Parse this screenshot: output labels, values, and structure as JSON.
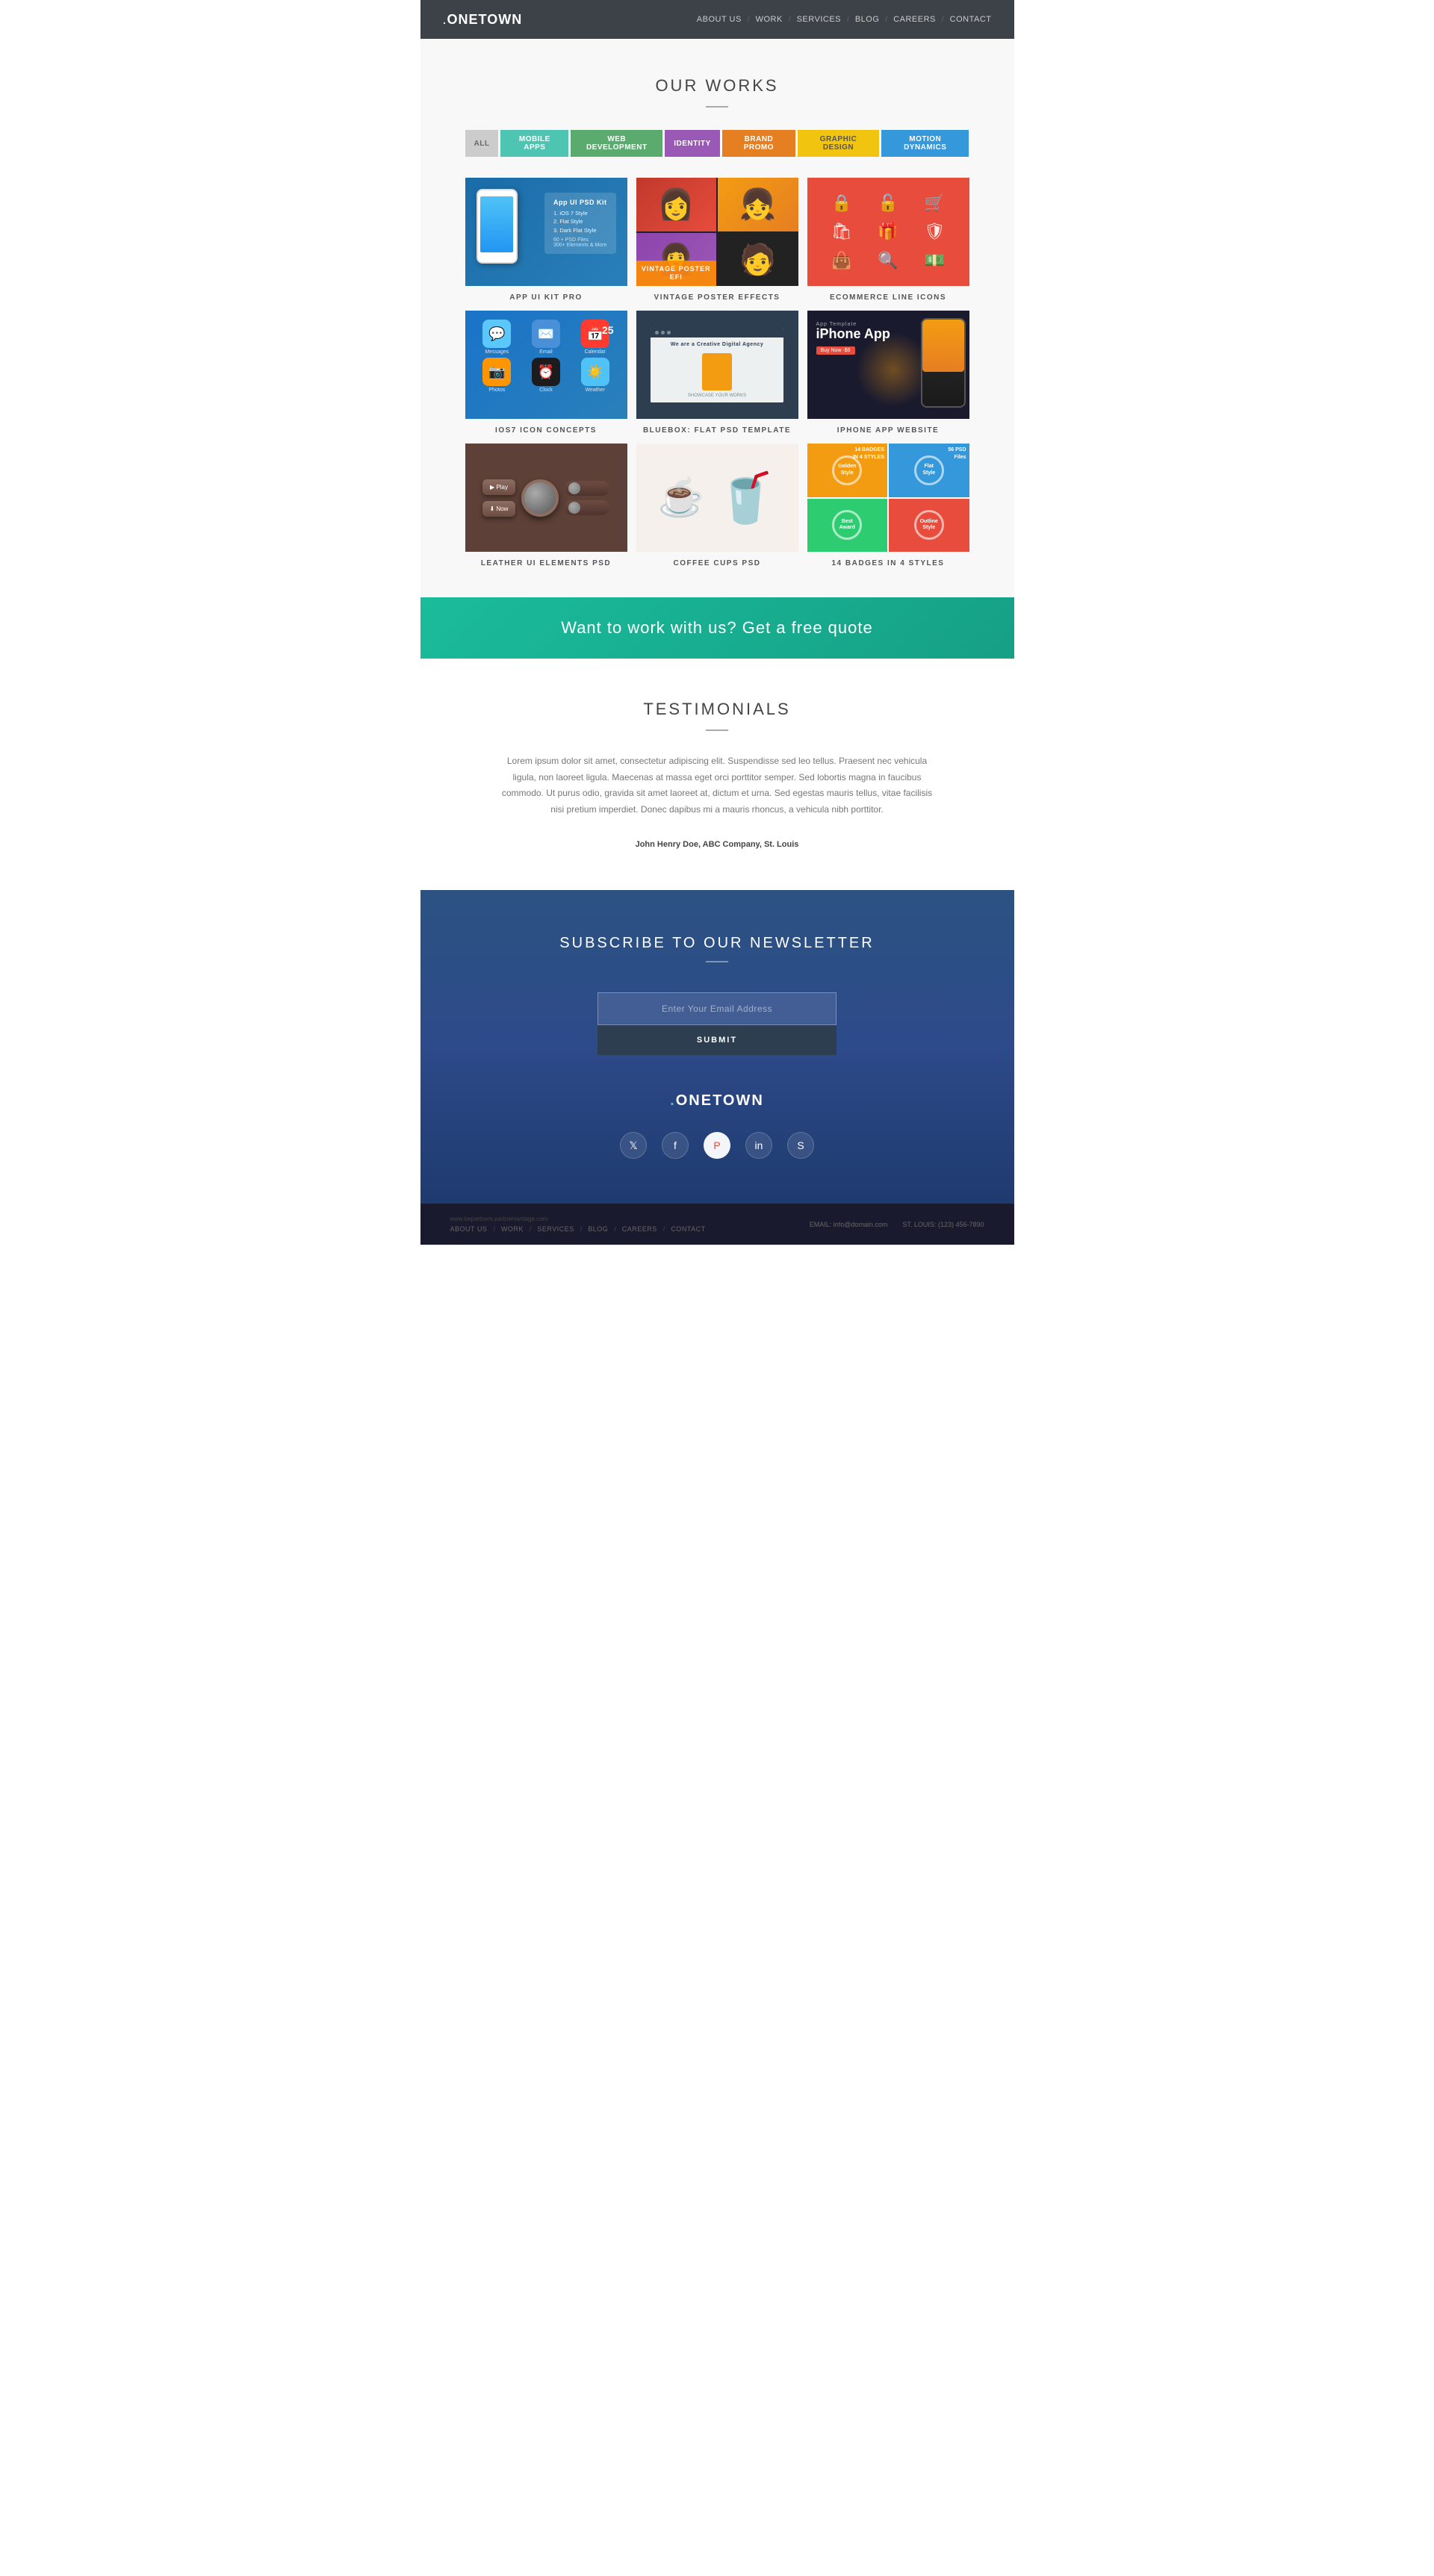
{
  "header": {
    "logo": ".ONETOWN",
    "logo_dot": ".",
    "logo_name": "ONETOWN",
    "nav_items": [
      {
        "label": "ABOUT US",
        "url": "#"
      },
      {
        "label": "WORK",
        "url": "#"
      },
      {
        "label": "SERVICES",
        "url": "#"
      },
      {
        "label": "BLOG",
        "url": "#"
      },
      {
        "label": "CAREERS",
        "url": "#"
      },
      {
        "label": "CONTACT",
        "url": "#"
      }
    ]
  },
  "works": {
    "section_title": "OUR WORKS",
    "filter_tabs": [
      {
        "label": "ALL",
        "class": "all"
      },
      {
        "label": "MOBILE APPS",
        "class": "mobile"
      },
      {
        "label": "WEB DEVELOPMENT",
        "class": "web"
      },
      {
        "label": "IDENTITY",
        "class": "identity"
      },
      {
        "label": "BRAND PROMO",
        "class": "brand"
      },
      {
        "label": "GRAPHIC DESIGN",
        "class": "graphic"
      },
      {
        "label": "MOTION DYNAMICS",
        "class": "motion"
      }
    ],
    "items": [
      {
        "label": "APP UI KIT PRO"
      },
      {
        "label": "VINTAGE POSTER EFFECTS"
      },
      {
        "label": "ECOMMERCE LINE ICONS"
      },
      {
        "label": "IOS7 ICON CONCEPTS"
      },
      {
        "label": "BLUEBOX: FLAT PSD TEMPLATE"
      },
      {
        "label": "IPHONE APP WEBSITE"
      },
      {
        "label": "LEATHER UI ELEMENTS PSD"
      },
      {
        "label": "COFFEE CUPS PSD"
      },
      {
        "label": "14 BADGES IN 4 STYLES"
      }
    ]
  },
  "cta": {
    "text": "Want to work with us?  Get a free quote"
  },
  "testimonials": {
    "section_title": "TESTIMONIALS",
    "quote": "Lorem ipsum dolor sit amet, consectetur adipiscing elit. Suspendisse sed leo tellus. Praesent nec vehicula ligula, non laoreet ligula. Maecenas at massa eget orci porttitor semper. Sed lobortis magna in faucibus commodo. Ut purus odio, gravida sit amet laoreet at, dictum et urna. Sed egestas mauris tellus, vitae facilisis nisi pretium imperdiet. Donec dapibus mi a mauris rhoncus, a vehicula nibh porttitor.",
    "author": "John Henry Doe, ABC Company, St. Louis"
  },
  "newsletter": {
    "title": "SUBSCRIBE TO OUR NEWSLETTER",
    "email_placeholder": "Enter Your Email Address",
    "submit_label": "SUBMIT",
    "logo": ".ONETOWN",
    "logo_dot": ".",
    "logo_name": "ONETOWN"
  },
  "social": {
    "icons": [
      {
        "name": "twitter",
        "symbol": "𝕏"
      },
      {
        "name": "facebook",
        "symbol": "f"
      },
      {
        "name": "pinterest",
        "symbol": "P"
      },
      {
        "name": "linkedin",
        "symbol": "in"
      },
      {
        "name": "skype",
        "symbol": "S"
      }
    ]
  },
  "footer": {
    "nav_items": [
      {
        "label": "ABOUT US"
      },
      {
        "label": "WORK"
      },
      {
        "label": "SERVICES"
      },
      {
        "label": "BLOG"
      },
      {
        "label": "CAREERS"
      },
      {
        "label": "CONTACT"
      }
    ],
    "email_label": "EMAIL:",
    "email": "info@domain.com",
    "location_label": "ST. LOUIS:",
    "phone": "(123) 456-7890",
    "url": "www.bepartners.partnervantage.com"
  },
  "bluebox": {
    "agency_text": "We are a Creative Digital Agency",
    "showcase_text": "SHOWCASE YOUR WORKS"
  },
  "app_ui": {
    "kit_title": "App UI PSD Kit",
    "items": [
      "1. iOS 7 Style",
      "2. Flat Style",
      "3. Dark Flat Style"
    ],
    "sub": "60 + PSD Files\n300+ Elements & More"
  },
  "vintage": {
    "overlay_line1": "VINTAGE POSTER EFI"
  },
  "iphone_app": {
    "app_label": "App Template",
    "app_name": "iPhone App",
    "buy_label": "Buy Now -$6"
  },
  "badges": {
    "title": "14 BADGES",
    "subtitle": "IN 4 STYLES",
    "info": "56 PSD Files"
  }
}
